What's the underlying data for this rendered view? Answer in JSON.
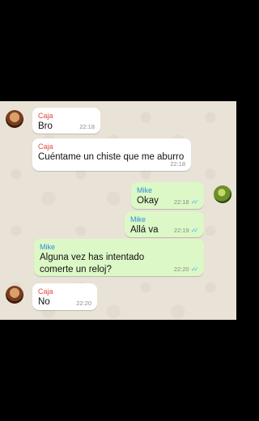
{
  "messages": [
    {
      "sender": "Caja",
      "text": "Bro",
      "time": "22:18",
      "direction": "in"
    },
    {
      "sender": "Caja",
      "text": "Cuéntame un chiste que me aburro",
      "time": "22:18",
      "direction": "in"
    },
    {
      "sender": "Mike",
      "text": "Okay",
      "time": "22:18",
      "direction": "out",
      "read": true
    },
    {
      "sender": "Mike",
      "text": "Allá va",
      "time": "22:19",
      "direction": "out",
      "read": true
    },
    {
      "sender": "Mike",
      "text": "Alguna vez has intentado comerte un reloj?",
      "time": "22:20",
      "direction": "out",
      "read": true
    },
    {
      "sender": "Caja",
      "text": "No",
      "time": "22:20",
      "direction": "in"
    }
  ],
  "ticks_glyph": "✓✓",
  "colors": {
    "incoming_bubble": "#ffffff",
    "outgoing_bubble": "#dcf8c6",
    "caja_name": "#e2483d",
    "mike_name": "#2f8fd8",
    "read_ticks": "#4fb6ec",
    "chat_background": "#e9e2d6"
  }
}
